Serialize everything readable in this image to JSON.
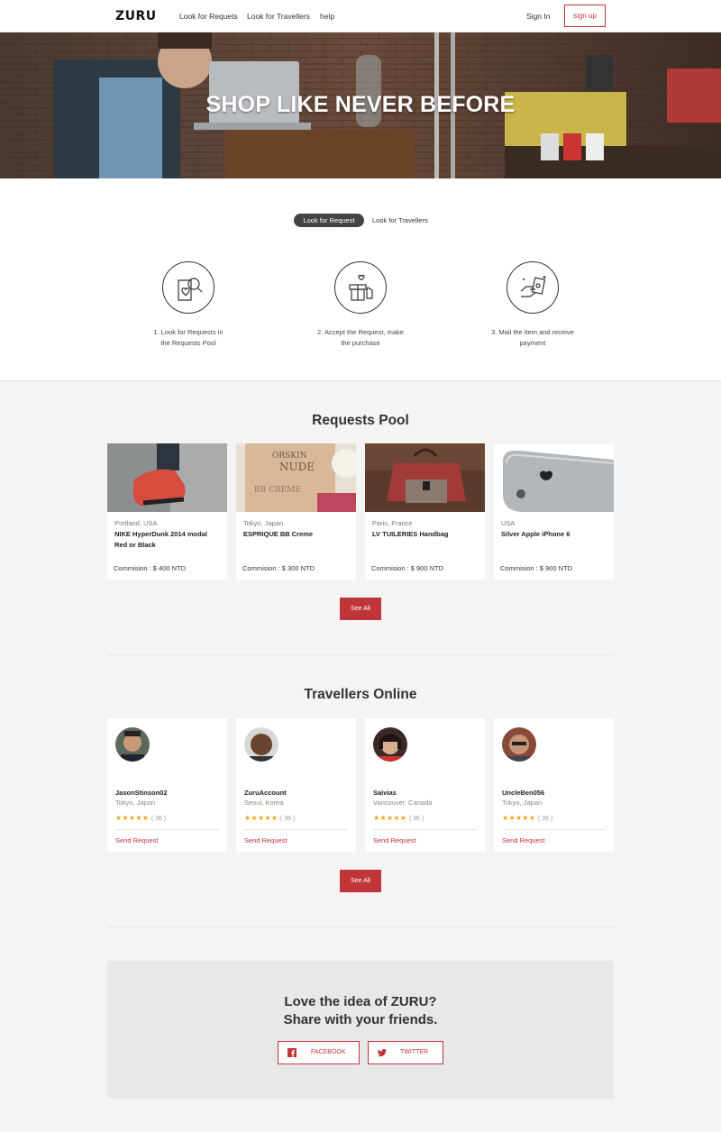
{
  "nav": {
    "logo": "ZURU",
    "links": [
      "Look for Requets",
      "Look for Travellers",
      "help"
    ],
    "signin": "Sign In",
    "signup": "sign up"
  },
  "hero": {
    "title": "SHOP LIKE NEVER BEFORE"
  },
  "how": {
    "tabs": [
      "Look for Request",
      "Look for Travellers"
    ],
    "steps": [
      {
        "line1": "1. Look for Requests in",
        "line2": "the Requests Pool",
        "icon": "search-request-icon"
      },
      {
        "line1": "2. Accept the Request, make",
        "line2": "the purchase",
        "icon": "gift-icon"
      },
      {
        "line1": "3. Mail the item and receive",
        "line2": "payment",
        "icon": "payment-hand-icon"
      }
    ]
  },
  "requests": {
    "title": "Requests Pool",
    "items": [
      {
        "location": "Portland, USA",
        "name": "NIKE HyperDunk 2014 modal Red or Black",
        "commission": "Commision : $ 400 NTD"
      },
      {
        "location": "Tokyo, Japan",
        "name": "ESPRIQUE BB Creme",
        "commission": "Commision : $ 300 NTD"
      },
      {
        "location": "Paris, France",
        "name": "LV TUILERIES Handbag",
        "commission": "Commision : $ 900 NTD"
      },
      {
        "location": "USA",
        "name": "Silver Apple iPhone 6",
        "commission": "Commision : $ 900 NTD"
      }
    ],
    "see_all": "See All"
  },
  "travellers": {
    "title": "Travellers Online",
    "items": [
      {
        "name": "JasonStinson02",
        "location": "Tokyo, Japan",
        "stars": "★★★★★",
        "count": "( 36 )",
        "action": "Send Request"
      },
      {
        "name": "ZuruAccount",
        "location": "Seoul, Korea",
        "stars": "★★★★★",
        "count": "( 36 )",
        "action": "Send Request"
      },
      {
        "name": "Saivias",
        "location": "Vancouver, Canada",
        "stars": "★★★★★",
        "count": "( 36 )",
        "action": "Send Request"
      },
      {
        "name": "UncleBen056",
        "location": "Tokyo, Japan",
        "stars": "★★★★★",
        "count": "( 36 )",
        "action": "Send Request"
      }
    ],
    "see_all": "See All"
  },
  "share": {
    "line1": "Love the idea of ZURU?",
    "line2": "Share with your friends.",
    "facebook": "FACEBOOK",
    "twitter": "TWITTER"
  },
  "colors": {
    "accent": "#c0353a",
    "star": "#f0a416"
  }
}
